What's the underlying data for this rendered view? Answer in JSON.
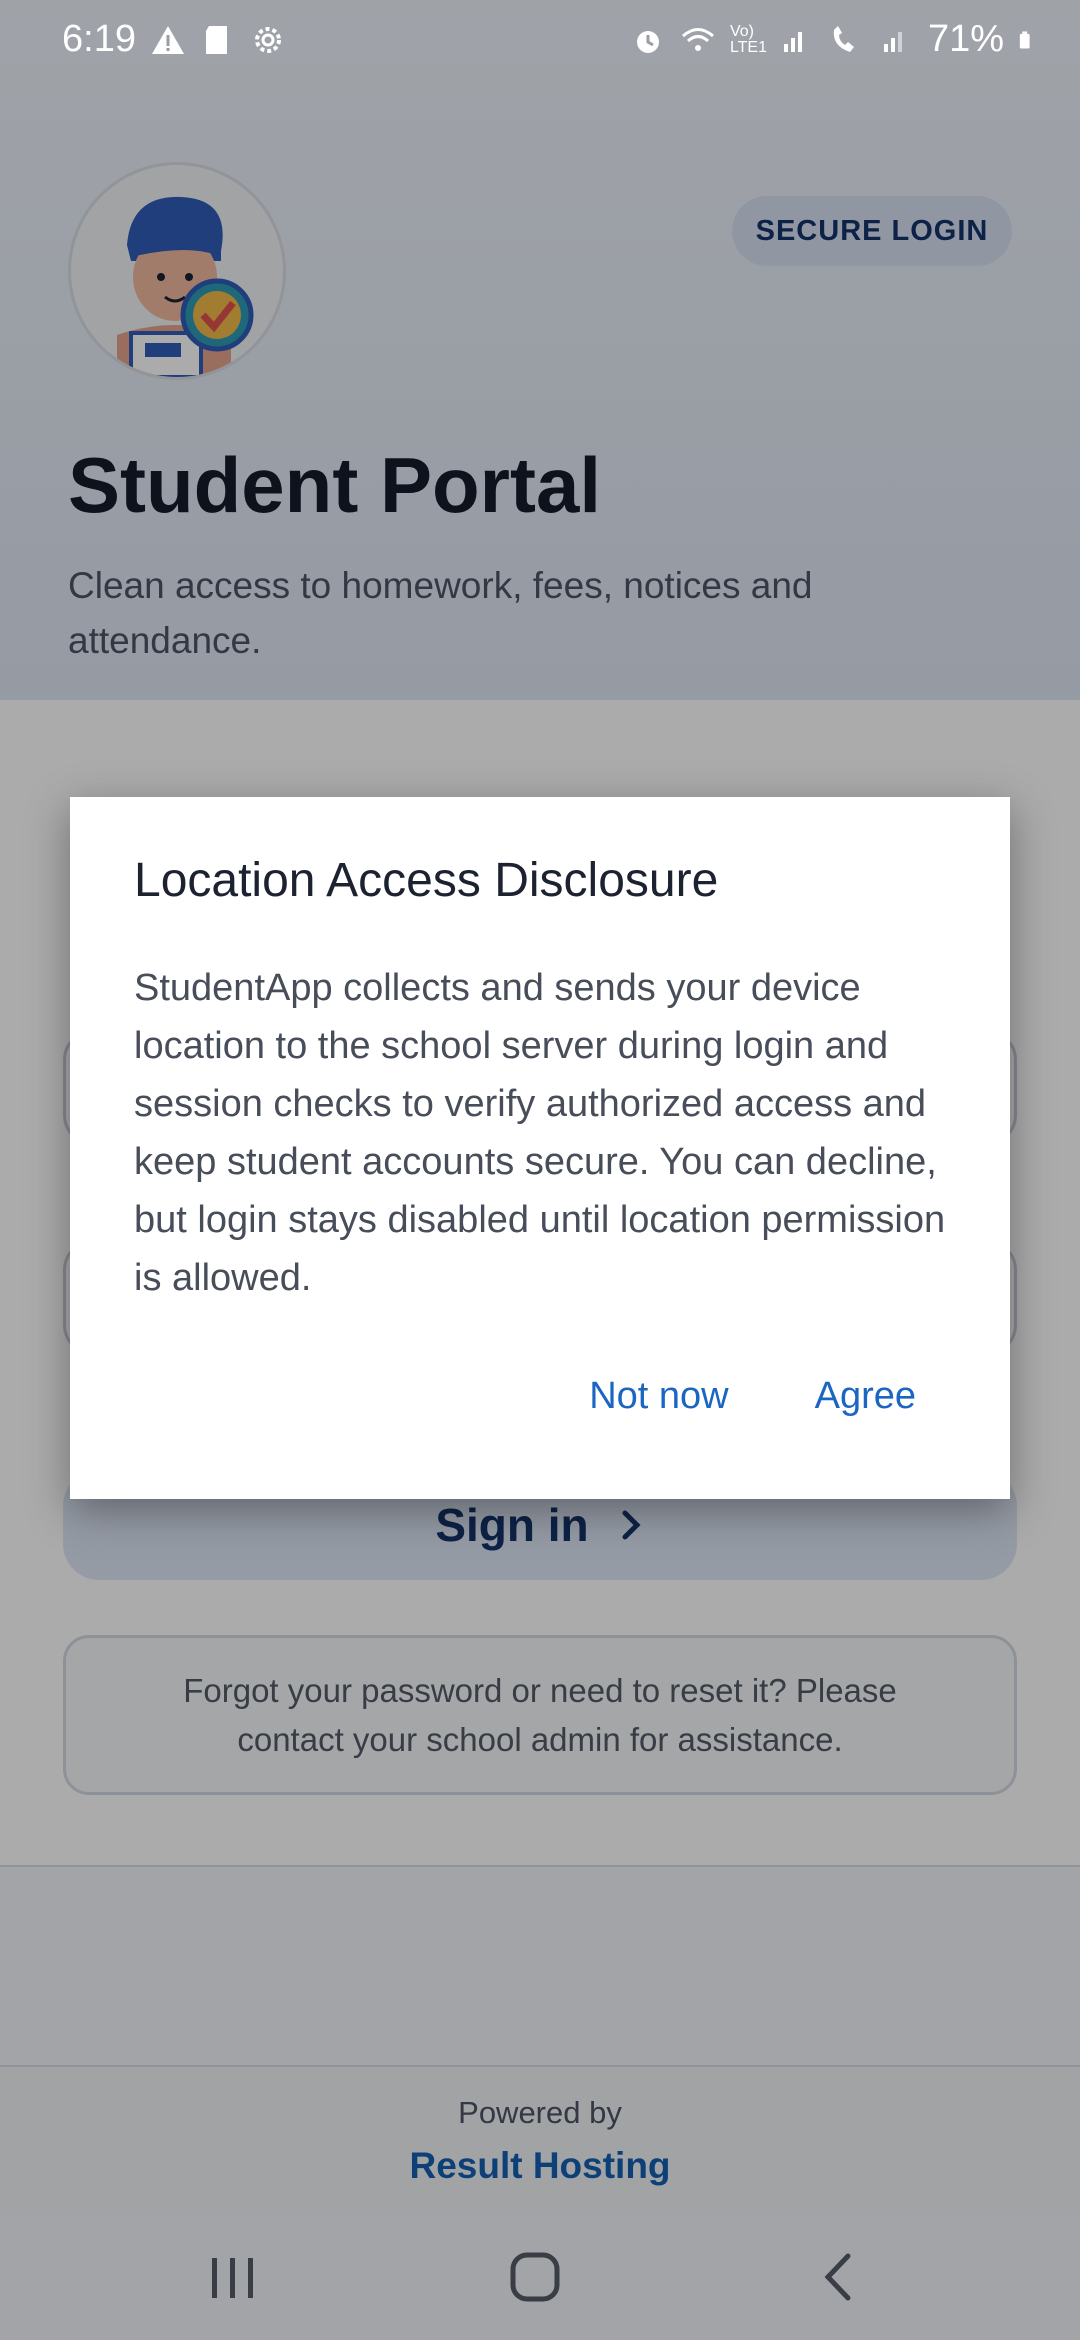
{
  "status_bar": {
    "time": "6:19",
    "battery": "71%",
    "network_label": "Vo) LTE1"
  },
  "hero": {
    "badge": "SECURE LOGIN",
    "title": "Student Portal",
    "subtitle": "Clean access to homework, fees, notices and attendance."
  },
  "form": {
    "sign_in_label": "Sign in",
    "help_text": "Forgot your password or need to reset it? Please contact your school admin for assistance."
  },
  "footer": {
    "powered_by": "Powered by",
    "brand": "Result Hosting"
  },
  "dialog": {
    "title": "Location Access Disclosure",
    "body": "StudentApp collects and sends your device location to the school server during login and session checks to verify authorized access and keep student accounts secure. You can decline, but login stays disabled until location permission is allowed.",
    "decline_label": "Not now",
    "agree_label": "Agree"
  },
  "icons": {
    "warning": "warning-icon",
    "sd_card": "sd-card-icon",
    "settings": "gear-icon",
    "alarm": "alarm-icon",
    "wifi": "wifi-icon",
    "signal": "signal-icon",
    "wifi_calling": "wifi-calling-icon",
    "battery": "battery-icon",
    "recent_apps": "recent-apps-icon",
    "home": "home-icon",
    "back": "back-icon",
    "chevron": "chevron-right-icon"
  },
  "colors": {
    "accent": "#1a66c2",
    "brand_dark": "#14336a",
    "title": "#151c2b"
  }
}
